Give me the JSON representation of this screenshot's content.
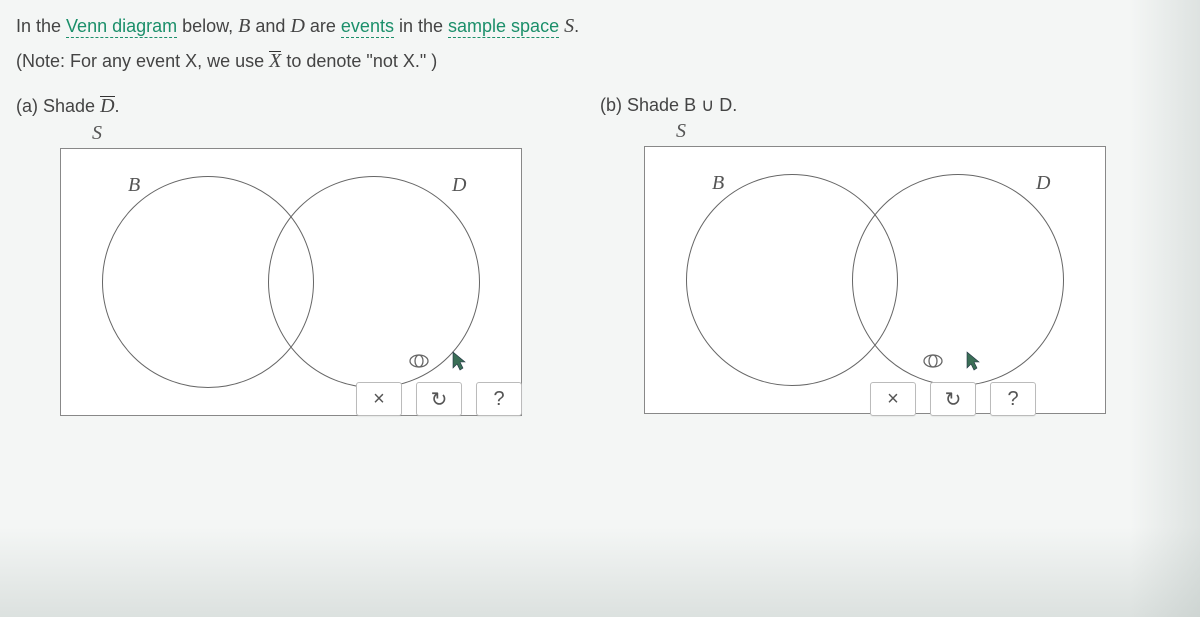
{
  "intro": {
    "pre": "In the ",
    "venn_link": "Venn diagram",
    "mid1": " below, ",
    "b": "B",
    "and": " and ",
    "d": "D",
    "are": " are ",
    "events_link": "events",
    "in_the": " in the ",
    "sample_link": "sample space",
    "space": " ",
    "s": "S",
    "end": "."
  },
  "note": {
    "pre": "(Note: For any event ",
    "x1": "X",
    "mid": ", we use ",
    "xbar": "X",
    "post": " to denote \"not ",
    "x2": "X",
    "end": ".\" )"
  },
  "a": {
    "label_pre": "(a) Shade ",
    "target": "D",
    "end": ".",
    "s": "S",
    "b": "B",
    "d": "D"
  },
  "b": {
    "label_pre": "(b) Shade ",
    "target": "B ∪ D",
    "end": ".",
    "s": "S",
    "b": "B",
    "d": "D"
  },
  "toolbar": {
    "clear": "×",
    "reset": "↻",
    "help": "?"
  }
}
